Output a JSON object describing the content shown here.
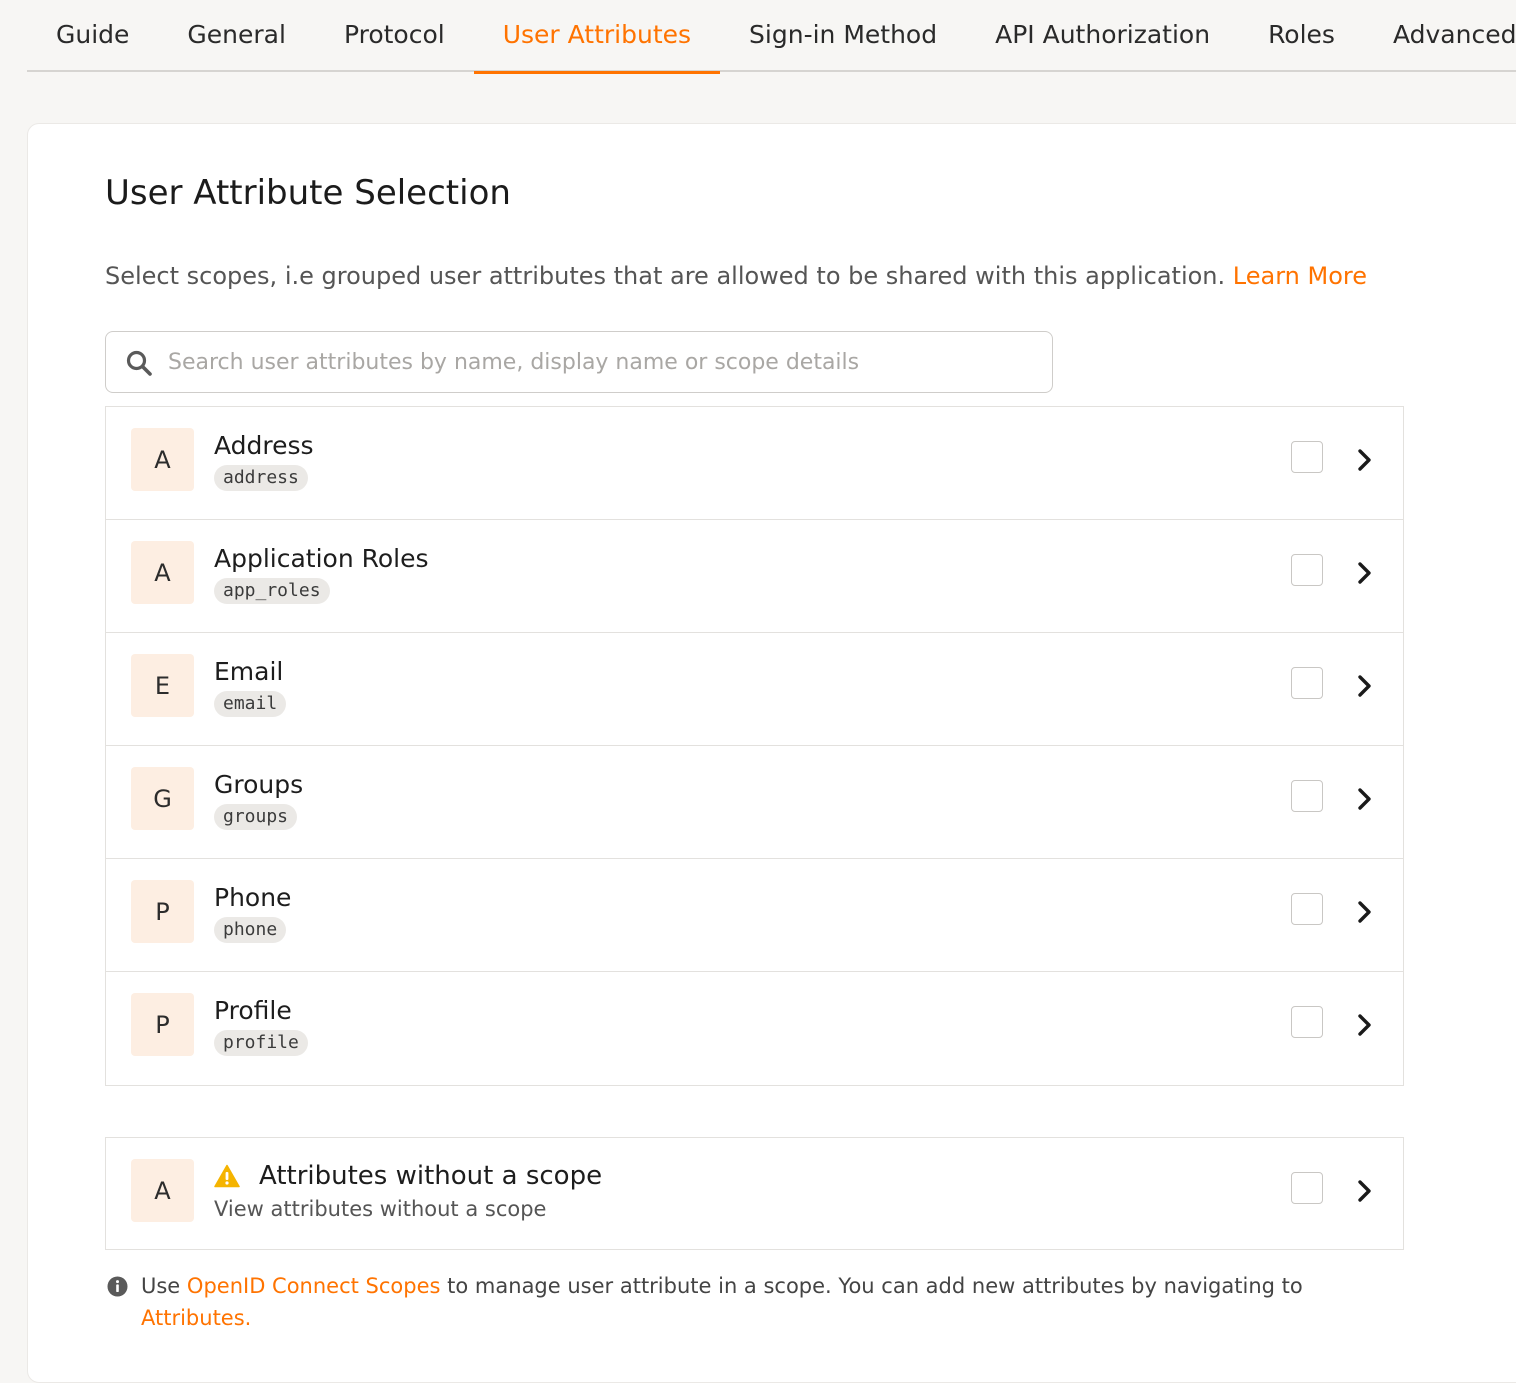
{
  "tabs": [
    {
      "label": "Guide",
      "active": false
    },
    {
      "label": "General",
      "active": false
    },
    {
      "label": "Protocol",
      "active": false
    },
    {
      "label": "User Attributes",
      "active": true
    },
    {
      "label": "Sign-in Method",
      "active": false
    },
    {
      "label": "API Authorization",
      "active": false
    },
    {
      "label": "Roles",
      "active": false
    },
    {
      "label": "Advanced",
      "active": false
    }
  ],
  "section": {
    "title": "User Attribute Selection",
    "description": "Select scopes, i.e grouped user attributes that are allowed to be shared with this application.",
    "learn_more": "Learn More"
  },
  "search": {
    "placeholder": "Search user attributes by name, display name or scope details",
    "value": ""
  },
  "scopes": [
    {
      "initial": "A",
      "name": "Address",
      "key": "address",
      "checked": false
    },
    {
      "initial": "A",
      "name": "Application Roles",
      "key": "app_roles",
      "checked": false
    },
    {
      "initial": "E",
      "name": "Email",
      "key": "email",
      "checked": false
    },
    {
      "initial": "G",
      "name": "Groups",
      "key": "groups",
      "checked": false
    },
    {
      "initial": "P",
      "name": "Phone",
      "key": "phone",
      "checked": false
    },
    {
      "initial": "P",
      "name": "Profile",
      "key": "profile",
      "checked": false
    }
  ],
  "no_scope": {
    "initial": "A",
    "title": "Attributes without a scope",
    "subtitle": "View attributes without a scope",
    "checked": false
  },
  "note": {
    "prefix": "Use",
    "link1": "OpenID Connect Scopes",
    "middle": "to manage user attribute in a scope. You can add new attributes by navigating to",
    "link2": "Attributes."
  },
  "colors": {
    "accent": "#ff7300",
    "avatar_bg": "#fdeee2",
    "warning": "#f5b400"
  },
  "icons": {
    "search": "search-icon",
    "chevron": "chevron-right-icon",
    "warning": "warning-icon",
    "info": "info-icon"
  }
}
